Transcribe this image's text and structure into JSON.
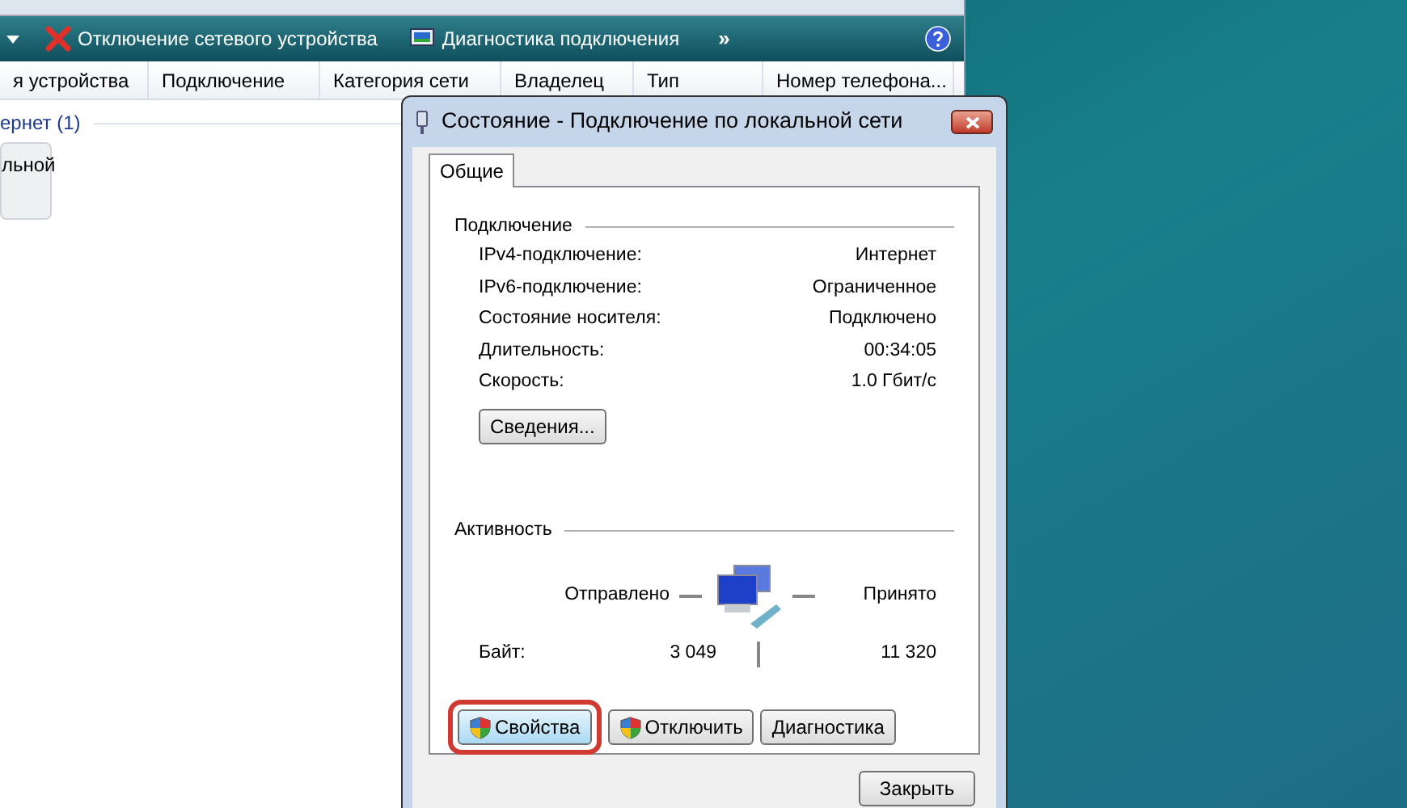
{
  "explorer": {
    "toolbar": [
      {
        "kind": "caret"
      },
      {
        "kind": "disconnect",
        "label": "Отключение сетевого устройства"
      },
      {
        "kind": "diagnose",
        "label": "Диагностика подключения"
      },
      {
        "kind": "more",
        "label": "»"
      },
      {
        "kind": "help"
      }
    ],
    "columns": [
      "я устройства",
      "Подключение",
      "Категория сети",
      "Владелец",
      "Тип",
      "Номер телефона..."
    ],
    "group": "ернет (1)",
    "item": "льной"
  },
  "dialog": {
    "title": "Состояние - Подключение по локальной сети",
    "tabs": [
      {
        "label": "Общие",
        "selected": true
      }
    ],
    "connection": {
      "title": "Подключение",
      "rows": [
        {
          "label": "IPv4-подключение:",
          "value": "Интернет"
        },
        {
          "label": "IPv6-подключение:",
          "value": "Ограниченное"
        },
        {
          "label": "Состояние носителя:",
          "value": "Подключено"
        },
        {
          "label": "Длительность:",
          "value": "00:34:05"
        },
        {
          "label": "Скорость:",
          "value": "1.0 Гбит/с"
        }
      ],
      "details_button": "Сведения..."
    },
    "activity": {
      "title": "Активность",
      "sent_label": "Отправлено",
      "received_label": "Принято",
      "bytes_label": "Байт:",
      "sent": "3 049",
      "received": "11 320"
    },
    "buttons": [
      {
        "label": "Свойства",
        "shield": true,
        "highlighted": true
      },
      {
        "label": "Отключить",
        "shield": true,
        "highlighted": false
      },
      {
        "label": "Диагностика",
        "shield": false,
        "highlighted": false
      }
    ],
    "close_button": "Закрыть"
  }
}
